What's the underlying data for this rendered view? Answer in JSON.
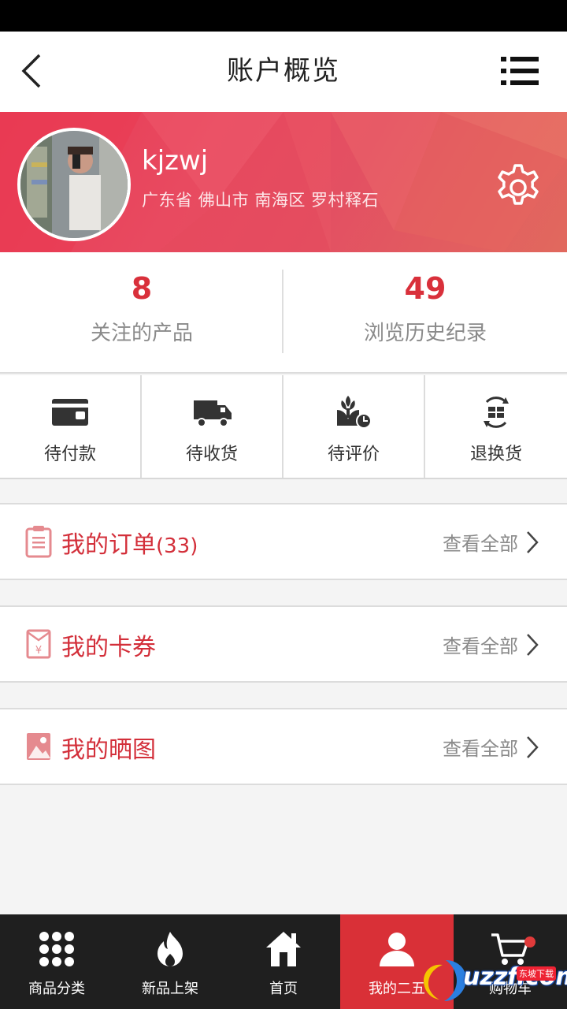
{
  "header": {
    "title": "账户概览"
  },
  "profile": {
    "username": "kjzwj",
    "address": "广东省 佛山市 南海区 罗村释石"
  },
  "stats": [
    {
      "value": "8",
      "label": "关注的产品"
    },
    {
      "value": "49",
      "label": "浏览历史纪录"
    }
  ],
  "order_status": [
    {
      "label": "待付款",
      "icon": "wallet-icon"
    },
    {
      "label": "待收货",
      "icon": "truck-icon"
    },
    {
      "label": "待评价",
      "icon": "rate-icon"
    },
    {
      "label": "退换货",
      "icon": "exchange-icon"
    }
  ],
  "sections": {
    "orders": {
      "label": "我的订单",
      "count": "(33)",
      "more": "查看全部"
    },
    "coupons": {
      "label": "我的卡券",
      "more": "查看全部"
    },
    "photos": {
      "label": "我的晒图",
      "more": "查看全部"
    }
  },
  "tabbar": [
    {
      "label": "商品分类",
      "icon": "grid-icon"
    },
    {
      "label": "新品上架",
      "icon": "flame-icon"
    },
    {
      "label": "首页",
      "icon": "home-icon"
    },
    {
      "label": "我的二五",
      "icon": "user-icon",
      "active": true
    },
    {
      "label": "购物车",
      "icon": "cart-icon"
    }
  ],
  "watermark": {
    "text": "uzzf.com",
    "tag": "东坡下载"
  },
  "colors": {
    "accent": "#d9303b",
    "banner": "#e84a60",
    "tabbar": "#1f1f1f"
  }
}
